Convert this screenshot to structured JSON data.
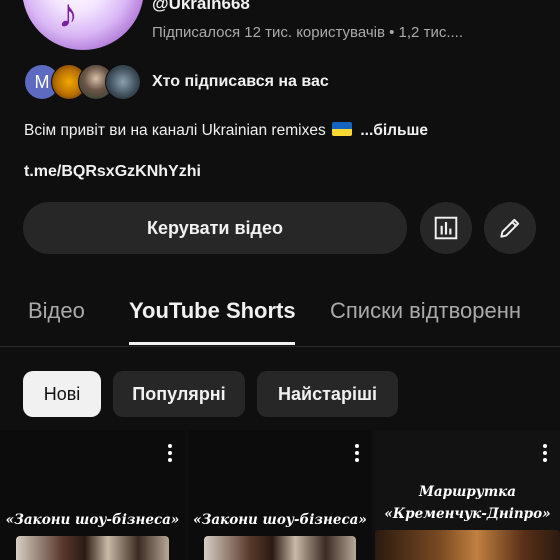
{
  "channel": {
    "handle": "@Ukrain668",
    "stats": "Підписалося 12 тис. користувачів • 1,2 тис....",
    "subscribers_label": "Хто підписався на вас",
    "first_subscriber_initial": "M",
    "description_text": "Всім привіт ви на каналі Ukrainian remixes",
    "description_more": "...більше",
    "link": "t.me/BQRsxGzKNhYzhi"
  },
  "actions": {
    "manage_videos": "Керувати відео"
  },
  "tabs": [
    {
      "label": "Відео",
      "active": false
    },
    {
      "label": "YouTube Shorts",
      "active": true
    },
    {
      "label": "Списки відтворенн",
      "active": false
    }
  ],
  "filters": [
    {
      "label": "Нові",
      "selected": true
    },
    {
      "label": "Популярні",
      "selected": false
    },
    {
      "label": "Найстаріші",
      "selected": false
    }
  ],
  "shorts": [
    {
      "caption": "«Закони шоу-бізнеса»"
    },
    {
      "caption": "«Закони шоу-бізнеса»"
    },
    {
      "caption_line1": "Маршрутка",
      "caption_line2": "«Кременчук-Дніпро»"
    }
  ],
  "colors": {
    "background": "#0f0f0f",
    "button_bg": "#272727",
    "text": "#f1f1f1",
    "secondary_text": "#aaaaaa",
    "selected_chip_bg": "#f1f1f1"
  },
  "icons": {
    "analytics": "bar-chart-icon",
    "edit": "pencil-icon",
    "more": "more-vert-icon",
    "flag": "ukraine-flag-icon"
  }
}
